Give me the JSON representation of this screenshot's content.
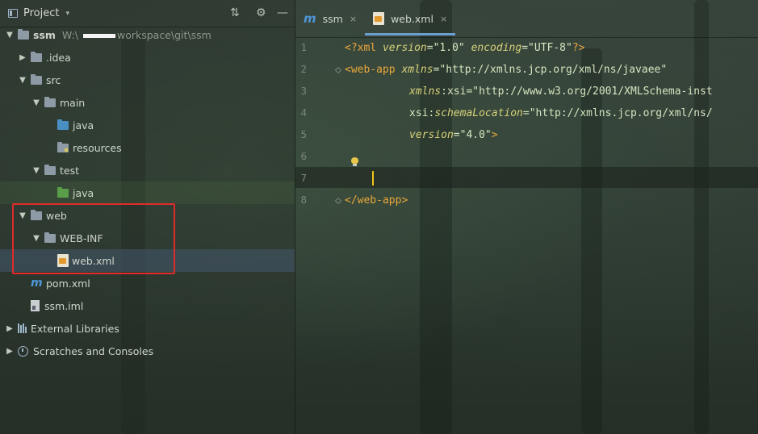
{
  "project": {
    "title": "Project",
    "caret": "▾",
    "tools": {
      "collapse": "⇅",
      "settings": "⚙",
      "hide": "—"
    }
  },
  "tree": [
    {
      "id": "ssm",
      "label": "ssm",
      "path_prefix": "W:\\",
      "path_suffix": "workspace\\git\\ssm"
    },
    {
      "id": "idea",
      "label": ".idea"
    },
    {
      "id": "src",
      "label": "src"
    },
    {
      "id": "main",
      "label": "main"
    },
    {
      "id": "java-main",
      "label": "java"
    },
    {
      "id": "resources",
      "label": "resources"
    },
    {
      "id": "test",
      "label": "test"
    },
    {
      "id": "java-test",
      "label": "java"
    },
    {
      "id": "web",
      "label": "web"
    },
    {
      "id": "web-inf",
      "label": "WEB-INF"
    },
    {
      "id": "web-xml",
      "label": "web.xml"
    },
    {
      "id": "pom",
      "label": "pom.xml"
    },
    {
      "id": "ssm-iml",
      "label": "ssm.iml"
    },
    {
      "id": "ext-lib",
      "label": "External Libraries"
    },
    {
      "id": "scratches",
      "label": "Scratches and Consoles"
    }
  ],
  "tabs": [
    {
      "icon": "m",
      "label": "ssm",
      "close": "×"
    },
    {
      "icon": "xml",
      "label": "web.xml",
      "close": "×"
    }
  ],
  "editor": {
    "line_numbers": [
      "1",
      "2",
      "3",
      "4",
      "5",
      "6",
      "7",
      "8"
    ],
    "current_line": 7,
    "code": {
      "l1_open": "<?xml ",
      "l1_a1": "version",
      "l1_v1": "=\"1.0\" ",
      "l1_a2": "encoding",
      "l1_v2": "=\"UTF-8\"",
      "l1_close": "?>",
      "l2_tag": "<web-app ",
      "l2_attr": "xmlns",
      "l2_val": "=\"http://xmlns.jcp.org/xml/ns/javaee\"",
      "l3_ns": "xmlns",
      "l3_colon": ":",
      "l3_attr": "xsi",
      "l3_val": "=\"http://www.w3.org/2001/XMLSchema-inst",
      "l4_ns": "xsi",
      "l4_colon": ":",
      "l4_attr": "schemaLocation",
      "l4_val": "=\"http://xmlns.jcp.org/xml/ns/",
      "l5_attr": "version",
      "l5_val": "=\"4.0\"",
      "l5_close": ">",
      "l8_tag": "</web-app>"
    }
  },
  "colors": {
    "tag": "#e8a73b",
    "attribute": "#d7d27a",
    "value": "#d7e4c0",
    "selection": "#46586e",
    "highlight_box": "#e02b2b",
    "caret": "#f0c419"
  }
}
